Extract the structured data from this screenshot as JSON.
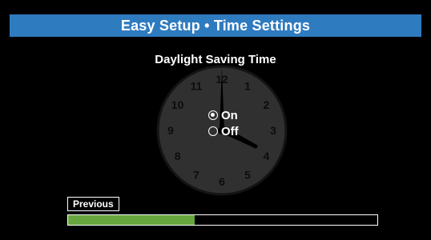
{
  "header": {
    "title": "Easy Setup • Time Settings"
  },
  "main": {
    "subtitle": "Daylight Saving Time",
    "clock_numbers": [
      "12",
      "1",
      "2",
      "3",
      "4",
      "5",
      "6",
      "7",
      "8",
      "9",
      "10",
      "11"
    ],
    "options": [
      {
        "label": "On",
        "selected": true
      },
      {
        "label": "Off",
        "selected": false
      }
    ]
  },
  "footer": {
    "previous_label": "Previous",
    "progress_fraction": 0.41
  },
  "colors": {
    "title_bar": "#2f7bbf",
    "progress_fill": "#67a53f",
    "clock_face": "#303030"
  }
}
